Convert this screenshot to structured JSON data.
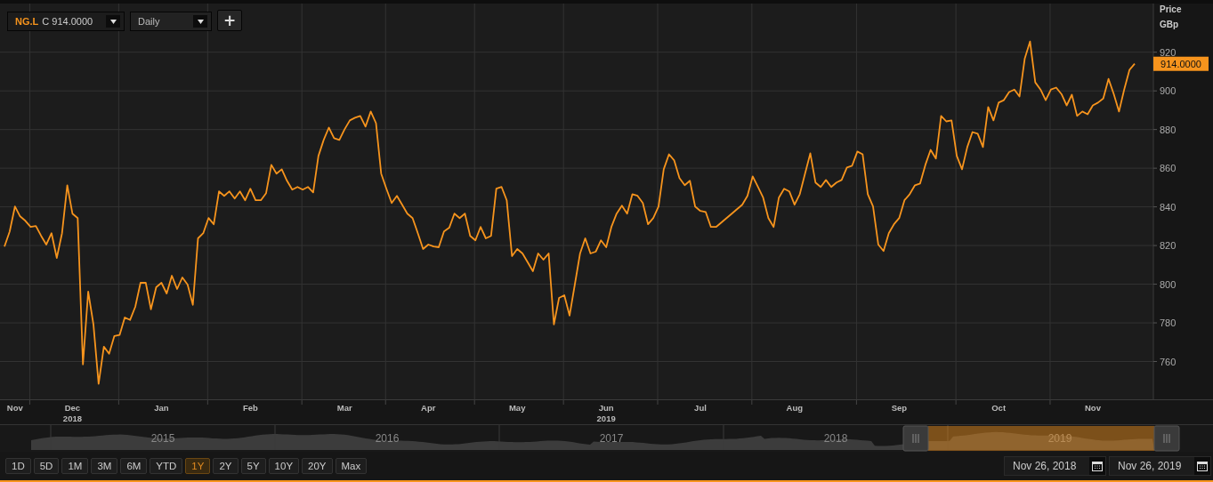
{
  "toolbar": {
    "symbol": "NG.L",
    "quote": "C 914.0000",
    "interval": "Daily",
    "add_button": "+"
  },
  "chart": {
    "axis_title": "Price",
    "unit": "GBp",
    "last_price": "914.0000",
    "chart_data": {
      "type": "line",
      "grid": true,
      "ylim": [
        740,
        947
      ],
      "yticks": [
        760,
        780,
        800,
        820,
        840,
        860,
        880,
        900,
        920
      ],
      "categories": [
        null,
        null,
        "Nov",
        null,
        null,
        null,
        null,
        null,
        null,
        null,
        null,
        null,
        null,
        "Dec",
        null,
        null,
        null,
        null,
        null,
        null,
        null,
        null,
        null,
        null,
        null,
        null,
        null,
        null,
        null,
        null,
        "Jan",
        null,
        null,
        null,
        null,
        null,
        null,
        null,
        null,
        null,
        null,
        null,
        null,
        null,
        null,
        null,
        null,
        "Feb",
        null,
        null,
        null,
        null,
        null,
        null,
        null,
        null,
        null,
        null,
        null,
        null,
        null,
        null,
        null,
        null,
        null,
        "Mar",
        null,
        null,
        null,
        null,
        null,
        null,
        null,
        null,
        null,
        null,
        null,
        null,
        null,
        null,
        null,
        "Apr",
        null,
        null,
        null,
        null,
        null,
        null,
        null,
        null,
        null,
        null,
        null,
        null,
        null,
        null,
        null,
        null,
        "May",
        null,
        null,
        null,
        null,
        null,
        null,
        null,
        null,
        null,
        null,
        null,
        null,
        null,
        null,
        null,
        null,
        "Jun",
        null,
        null,
        null,
        null,
        null,
        null,
        null,
        null,
        null,
        null,
        null,
        null,
        null,
        null,
        null,
        null,
        null,
        "Jul",
        null,
        null,
        null,
        null,
        null,
        null,
        null,
        null,
        null,
        null,
        null,
        null,
        null,
        null,
        null,
        null,
        null,
        "Aug",
        null,
        null,
        null,
        null,
        null,
        null,
        null,
        null,
        null,
        null,
        null,
        null,
        null,
        null,
        null,
        null,
        null,
        null,
        null,
        "Sep",
        null,
        null,
        null,
        null,
        null,
        null,
        null,
        null,
        null,
        null,
        null,
        null,
        null,
        null,
        null,
        null,
        null,
        null,
        "Oct",
        null,
        null,
        null,
        null,
        null,
        null,
        null,
        null,
        null,
        null,
        null,
        null,
        null,
        null,
        null,
        null,
        null,
        "Nov",
        null,
        null,
        null,
        null,
        null,
        null,
        null,
        null
      ],
      "series": [
        {
          "color": "#f7941d",
          "values": [
            819.5,
            827.3,
            840.2,
            835.1,
            832.8,
            829.6,
            830.1,
            825,
            820.5,
            826.4,
            813.6,
            826.4,
            851.2,
            836.5,
            834.2,
            758.5,
            796.1,
            779.2,
            748.4,
            767.7,
            764,
            773.2,
            773.7,
            782.8,
            781.5,
            788.3,
            800.7,
            800.7,
            787,
            798.4,
            800.7,
            795.2,
            804.4,
            797.5,
            803.5,
            799.8,
            789.3,
            823.7,
            826.4,
            834.2,
            831,
            848,
            845.7,
            848,
            844.3,
            848,
            843.4,
            849.4,
            843.4,
            843.4,
            847.1,
            861.7,
            857.2,
            859.4,
            853.5,
            848.9,
            850.3,
            848.9,
            850.3,
            847.5,
            866.3,
            874.6,
            881,
            875.5,
            874.6,
            880.1,
            884.7,
            886.1,
            887,
            881.5,
            889.3,
            883.3,
            857.2,
            849.4,
            842,
            845.7,
            841.1,
            836.5,
            834.2,
            826.4,
            818.2,
            820.5,
            819.5,
            819.1,
            827.3,
            829.2,
            836.5,
            834.2,
            836.5,
            825,
            822.7,
            829.6,
            823.7,
            825,
            849.4,
            850.3,
            843.4,
            814.5,
            818.2,
            815.9,
            811.3,
            806.7,
            815.9,
            812.7,
            815.9,
            779.2,
            792.9,
            794.3,
            783.8,
            799.8,
            815.9,
            823.7,
            815.9,
            816.8,
            822.7,
            819.1,
            829.6,
            836.5,
            840.6,
            836.5,
            846.6,
            845.7,
            842,
            831,
            834.2,
            840.2,
            859.4,
            867.2,
            864,
            854.9,
            851.2,
            853.5,
            840.2,
            837.9,
            837.4,
            829.6,
            829.6,
            831.9,
            834.2,
            836.5,
            838.8,
            841.1,
            845.7,
            855.8,
            850.3,
            844.8,
            834.2,
            829.6,
            844.8,
            849.4,
            848,
            841.1,
            846.6,
            857.2,
            867.7,
            852.6,
            850.3,
            853.9,
            850.3,
            852.6,
            853.9,
            860.4,
            861.3,
            868.6,
            867.2,
            846.6,
            840.2,
            820.5,
            817.2,
            826.4,
            831,
            834.2,
            843.4,
            846.6,
            851.2,
            852.1,
            861.7,
            869.5,
            865,
            887,
            884.2,
            884.7,
            866.3,
            859.4,
            870.9,
            878.7,
            877.8,
            870.9,
            891.6,
            884.7,
            893.9,
            895.2,
            899.4,
            900.7,
            897.1,
            916.8,
            925.5,
            904.4,
            900.7,
            895.2,
            900.7,
            901.7,
            898.4,
            892.5,
            898,
            887,
            889.3,
            887.9,
            892.5,
            893.9,
            896.1,
            906.2,
            898.4,
            889.3,
            900.7,
            910.8,
            914
          ]
        }
      ]
    },
    "year_labels": [
      "2018",
      "2019"
    ]
  },
  "navigator": {
    "years": [
      "2015",
      "2016",
      "2017",
      "2018",
      "2019"
    ]
  },
  "ranges": [
    {
      "label": "1D",
      "selected": false
    },
    {
      "label": "5D",
      "selected": false
    },
    {
      "label": "1M",
      "selected": false
    },
    {
      "label": "3M",
      "selected": false
    },
    {
      "label": "6M",
      "selected": false
    },
    {
      "label": "YTD",
      "selected": false
    },
    {
      "label": "1Y",
      "selected": true
    },
    {
      "label": "2Y",
      "selected": false
    },
    {
      "label": "5Y",
      "selected": false
    },
    {
      "label": "10Y",
      "selected": false
    },
    {
      "label": "20Y",
      "selected": false
    },
    {
      "label": "Max",
      "selected": false
    }
  ],
  "date_from": "Nov 26, 2018",
  "date_to": "Nov 26, 2019"
}
